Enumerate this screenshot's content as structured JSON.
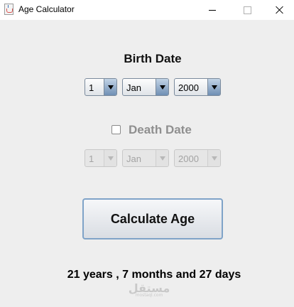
{
  "window": {
    "title": "Age Calculator",
    "icon": "java-cup-icon"
  },
  "birth": {
    "heading": "Birth Date",
    "day": "1",
    "month": "Jan",
    "year": "2000"
  },
  "death": {
    "label": "Death Date",
    "checked": false,
    "day": "1",
    "month": "Jan",
    "year": "2000",
    "enabled": false
  },
  "actions": {
    "calculate_label": "Calculate Age"
  },
  "result": {
    "text": "21 years , 7 months and 27 days"
  },
  "watermark": {
    "arabic": "مستقل",
    "latin": "mostaql.com"
  },
  "colors": {
    "background": "#eeeeee",
    "button_border": "#7fa3c8",
    "combo_arrow": "#6f8fb4",
    "disabled_text": "#8f8f8f"
  }
}
